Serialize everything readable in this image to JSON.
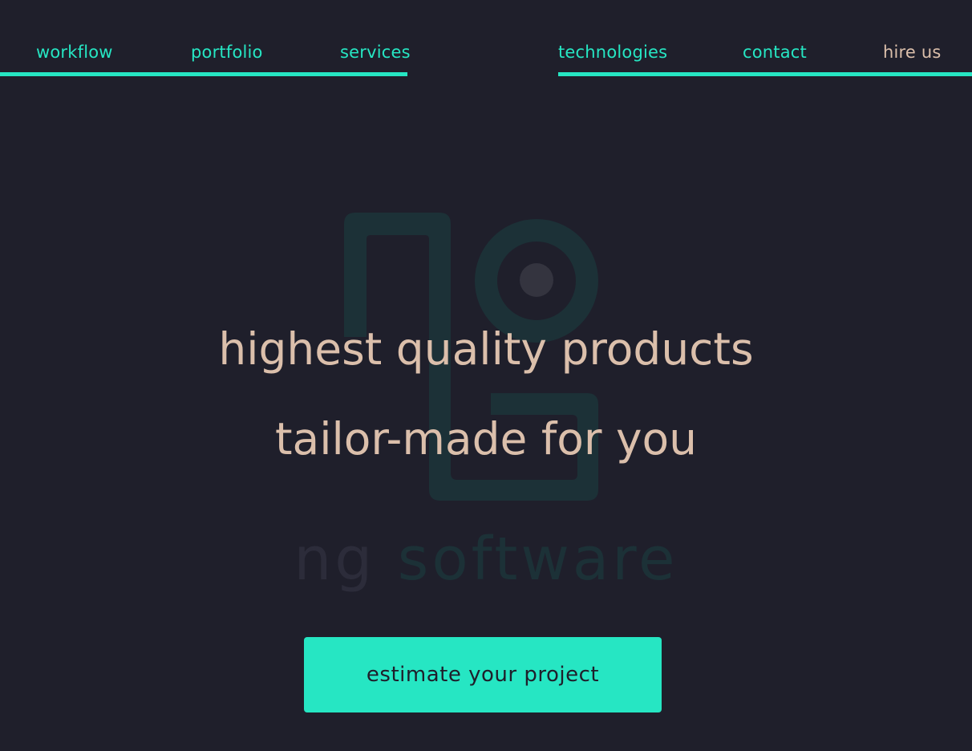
{
  "nav": {
    "left": [
      {
        "label": "workflow"
      },
      {
        "label": "portfolio"
      },
      {
        "label": "services"
      }
    ],
    "right": [
      {
        "label": "technologies"
      },
      {
        "label": "contact"
      },
      {
        "label": "hire us"
      }
    ]
  },
  "hero": {
    "line1": "highest quality products",
    "line2": "tailor-made for you"
  },
  "brand": {
    "part1": "ng",
    "part2": "software"
  },
  "cta": {
    "label": "estimate your project"
  },
  "colors": {
    "background": "#1f1f2b",
    "accent": "#26e6c3",
    "text": "#dbbfab",
    "watermark_teal": "#1c3137",
    "watermark_gray": "#2c2c3a"
  }
}
